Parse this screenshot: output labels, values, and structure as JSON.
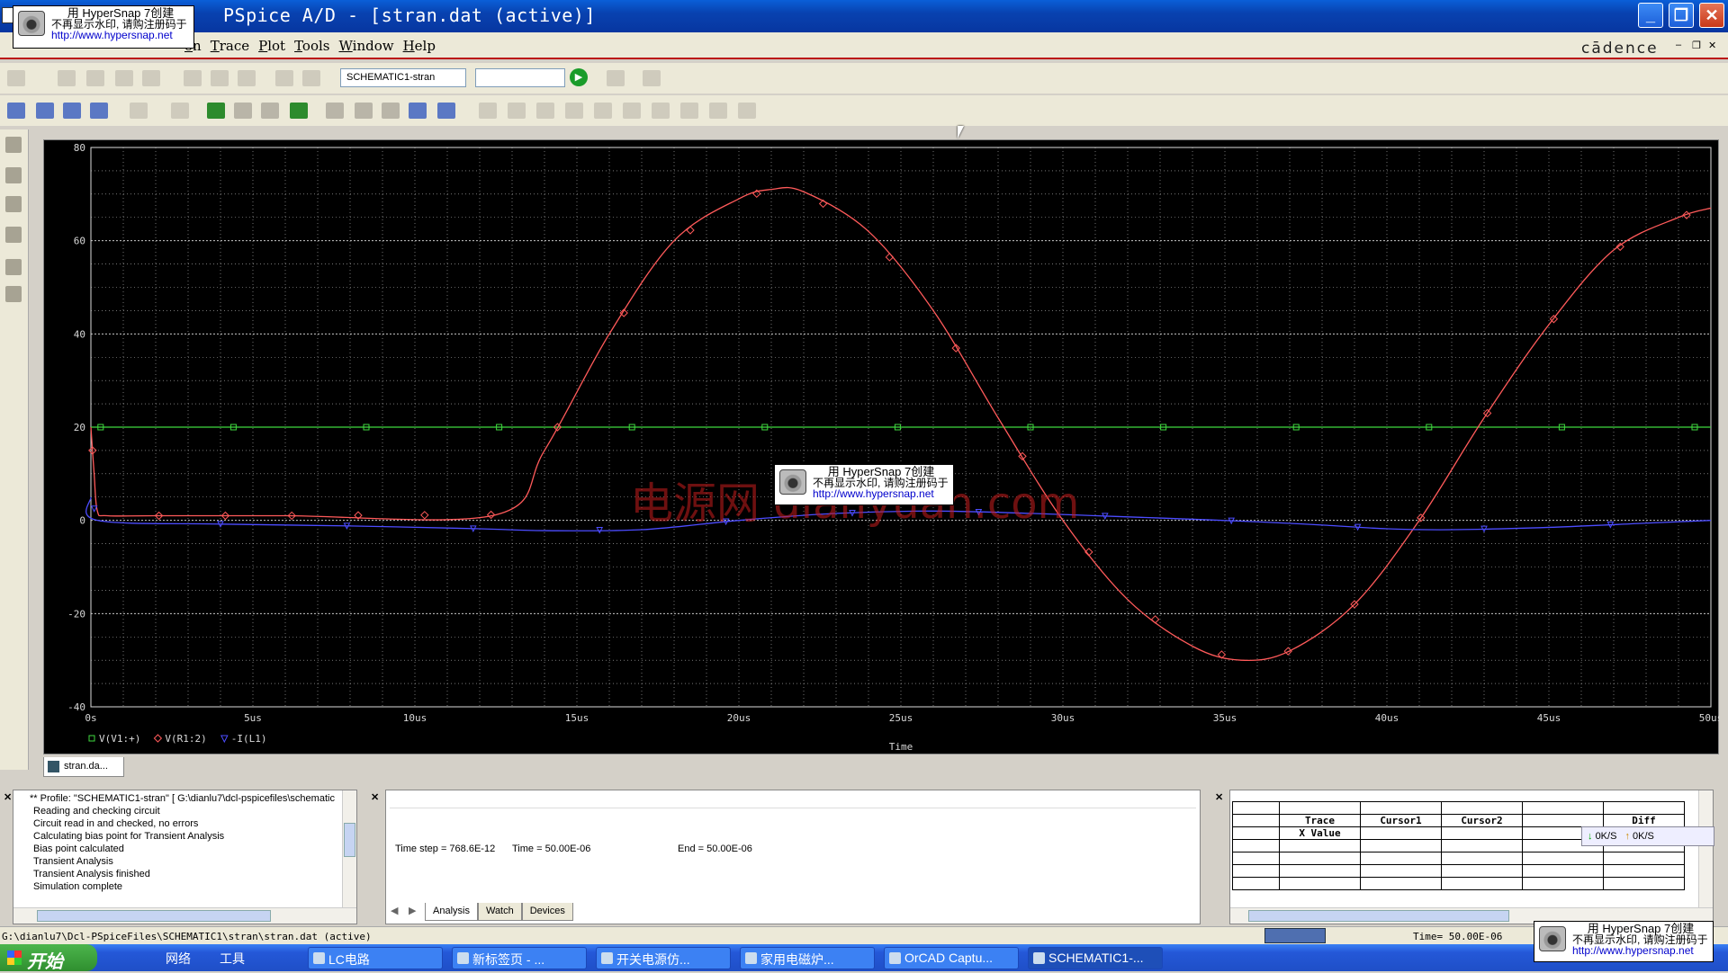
{
  "window": {
    "title": "PSpice A/D  - [stran.dat (active)]"
  },
  "menu": {
    "items": [
      "on",
      "Trace",
      "Plot",
      "Tools",
      "Window",
      "Help"
    ],
    "brand": "cādence"
  },
  "toolbar": {
    "profile_value": "SCHEMATIC1-stran",
    "second_value": ""
  },
  "chart_data": {
    "type": "line",
    "xlabel": "Time",
    "ylabel": "",
    "xlim": [
      0,
      50
    ],
    "ylim": [
      -40,
      80
    ],
    "x_unit": "us",
    "x_ticks": [
      "0s",
      "5us",
      "10us",
      "15us",
      "20us",
      "25us",
      "30us",
      "35us",
      "40us",
      "45us",
      "50us"
    ],
    "y_ticks": [
      "80",
      "60",
      "40",
      "20",
      "0",
      "-20",
      "-40"
    ],
    "grid": true,
    "series": [
      {
        "name": "V(V1:+)",
        "color": "#3fd93f",
        "marker": "square",
        "x": [
          0,
          50
        ],
        "y": [
          20,
          20
        ]
      },
      {
        "name": "V(R1:2)",
        "color": "#ff5a5a",
        "marker": "diamond",
        "x": [
          0,
          0.1,
          0.2,
          0.5,
          2,
          6,
          12.5,
          14,
          16,
          18,
          20,
          21,
          22,
          24,
          26,
          28,
          30,
          32,
          34,
          35.5,
          37,
          39,
          41,
          43,
          45,
          47,
          49,
          50
        ],
        "y": [
          20,
          10,
          2,
          1,
          1,
          1,
          1.2,
          15,
          40,
          60,
          69,
          71,
          70.5,
          62,
          45,
          22,
          0,
          -17,
          -27,
          -30,
          -28,
          -18,
          0,
          22,
          42,
          58,
          65,
          67
        ]
      },
      {
        "name": "-I(L1)",
        "color": "#4c4cff",
        "marker": "triangle",
        "x": [
          0,
          0.2,
          4,
          8,
          12,
          14,
          17,
          20,
          23,
          26,
          29,
          31,
          33,
          36,
          38,
          40,
          42,
          45,
          48,
          50
        ],
        "y": [
          5,
          0,
          -0.8,
          -1.2,
          -1.8,
          -2.2,
          -2,
          0,
          1.5,
          2,
          1.5,
          1,
          0.5,
          -0.3,
          -1,
          -1.8,
          -2,
          -1.5,
          -0.6,
          0
        ]
      }
    ]
  },
  "doc_tab": {
    "label": "stran.da..."
  },
  "output": {
    "lines": [
      "** Profile: \"SCHEMATIC1-stran\"  [ G:\\dianlu7\\dcl-pspicefiles\\schematic",
      "Reading and checking circuit",
      "Circuit read in and checked, no errors",
      "Calculating bias point for Transient Analysis",
      "Bias point calculated",
      "Transient Analysis",
      "Transient Analysis finished",
      "Simulation complete"
    ]
  },
  "sim_status": {
    "timestep": "Time step =  768.6E-12",
    "time": "Time =  50.00E-06",
    "end": "End =  50.00E-06"
  },
  "sim_tabs": [
    "Analysis",
    "Watch",
    "Devices"
  ],
  "probe": {
    "headers": [
      "Trace",
      "Cursor1",
      "Cursor2",
      "",
      "Diff"
    ],
    "row": "X Value",
    "speed_down": "0K/S",
    "speed_up": "0K/S"
  },
  "statusbar": {
    "path": "G:\\dianlu7\\Dcl-PSpiceFiles\\SCHEMATIC1\\stran\\stran.dat (active)",
    "time": "Time= 50.00E-06"
  },
  "taskbar": {
    "start": "开始",
    "quick": [
      "网络",
      "工具"
    ],
    "tasks": [
      "LC电路",
      "新标签页 - ...",
      "开关电源仿...",
      "家用电磁炉...",
      "OrCAD Captu...",
      "SCHEMATIC1-..."
    ]
  },
  "watermark": {
    "line1": "用 HyperSnap 7创建",
    "line2": "不再显示水印, 请购注册码于",
    "line3": "http://www.hypersnap.net",
    "site": "电源网 dianyuan.com"
  }
}
